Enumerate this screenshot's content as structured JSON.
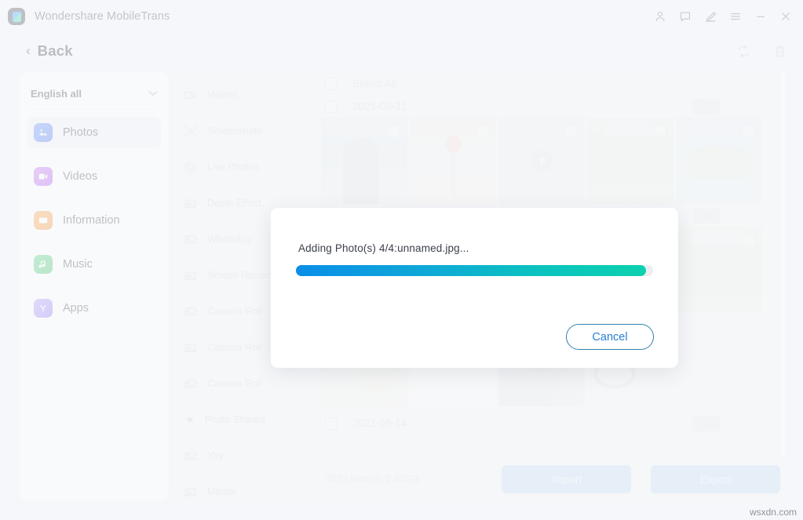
{
  "window": {
    "app_title": "Wondershare MobileTrans",
    "controls": [
      {
        "name": "account-icon",
        "label": "Account"
      },
      {
        "name": "feedback-icon",
        "label": "Feedback"
      },
      {
        "name": "edit-icon",
        "label": "Edit"
      },
      {
        "name": "menu-icon",
        "label": "Menu"
      },
      {
        "name": "minimize-icon",
        "label": "Minimize"
      },
      {
        "name": "close-icon",
        "label": "Close"
      }
    ]
  },
  "header": {
    "back_label": "Back",
    "back_chevron": "‹",
    "tools": [
      {
        "name": "refresh-icon",
        "label": "Refresh"
      },
      {
        "name": "delete-icon",
        "label": "Delete"
      }
    ]
  },
  "sidebar": {
    "language": {
      "value": "English all",
      "caret": "∨"
    },
    "items": [
      {
        "label": "Photos",
        "icon": "photos-icon",
        "active": true
      },
      {
        "label": "Videos",
        "icon": "videos-icon",
        "active": false
      },
      {
        "label": "Information",
        "icon": "information-icon",
        "active": false
      },
      {
        "label": "Music",
        "icon": "music-icon",
        "active": false
      },
      {
        "label": "Apps",
        "icon": "apps-icon",
        "active": false
      }
    ]
  },
  "categories": [
    {
      "label": "Videos",
      "icon": "video-camera-icon",
      "type": "item"
    },
    {
      "label": "Screenshots",
      "icon": "screenshot-icon",
      "type": "item"
    },
    {
      "label": "Live Photos",
      "icon": "live-photo-icon",
      "type": "item"
    },
    {
      "label": "Depth Effect",
      "icon": "photo-icon",
      "type": "item"
    },
    {
      "label": "WhatsApp",
      "icon": "photo-icon",
      "type": "item"
    },
    {
      "label": "Screen Recorder",
      "icon": "photo-icon",
      "type": "item"
    },
    {
      "label": "Camera Roll",
      "icon": "photo-icon",
      "type": "item"
    },
    {
      "label": "Camera Roll",
      "icon": "photo-icon",
      "type": "item"
    },
    {
      "label": "Camera Roll",
      "icon": "photo-icon",
      "type": "item"
    },
    {
      "label": "Photo Shared",
      "icon": "caret-down-icon",
      "type": "group"
    },
    {
      "label": "Yay",
      "icon": "photo-icon",
      "type": "item"
    },
    {
      "label": "Meishi",
      "icon": "photo-icon",
      "type": "item"
    }
  ],
  "main": {
    "select_all_label": "Select All",
    "groups": [
      {
        "date": "2021-08-31",
        "count": "5",
        "thumbs": [
          {
            "name": "thumb-person",
            "art": "t-person",
            "video": false
          },
          {
            "name": "thumb-flowers",
            "art": "t-flower",
            "video": false
          },
          {
            "name": "thumb-video-clip",
            "art": "t-video",
            "video": true
          },
          {
            "name": "thumb-leaves",
            "art": "t-leaves",
            "video": false
          },
          {
            "name": "thumb-palm-beach",
            "art": "t-palm",
            "video": false
          }
        ]
      },
      {
        "date": "",
        "count": "9",
        "thumbs": [
          {
            "name": "thumb-hidden-1",
            "art": "t-person",
            "video": false
          },
          {
            "name": "thumb-hidden-2",
            "art": "t-flower",
            "video": false
          },
          {
            "name": "thumb-hidden-3",
            "art": "t-video",
            "video": true
          },
          {
            "name": "thumb-hidden-4",
            "art": "t-leaves",
            "video": false
          },
          {
            "name": "thumb-leaves-2",
            "art": "t-leaves",
            "video": false
          }
        ]
      },
      {
        "date": "",
        "count": "",
        "thumbs": [
          {
            "name": "thumb-umbrella",
            "art": "t-umbrella",
            "video": false
          },
          {
            "name": "thumb-infographic",
            "art": "t-chart",
            "video": false
          },
          {
            "name": "thumb-video-clip-2",
            "art": "t-video2",
            "video": true
          },
          {
            "name": "thumb-cable",
            "art": "t-cable",
            "video": false
          }
        ]
      },
      {
        "date": "2021-05-14",
        "count": "3",
        "thumbs": []
      }
    ]
  },
  "bottom": {
    "count_text": "3013 item(s), 2.03GB",
    "import_label": "Import",
    "export_label": "Export"
  },
  "modal": {
    "message": "Adding Photo(s) 4/4:unnamed.jpg...",
    "progress_percent": 98,
    "cancel_label": "Cancel"
  },
  "watermark": "wsxdn.com",
  "colors": {
    "accent_blue": "#2a7fd4",
    "progress_start": "#0a8ee8",
    "progress_end": "#0bd1ae",
    "window_bg": "#f3f5f9",
    "panel_bg": "#ffffff",
    "disabled_button": "#b9d6f2"
  }
}
